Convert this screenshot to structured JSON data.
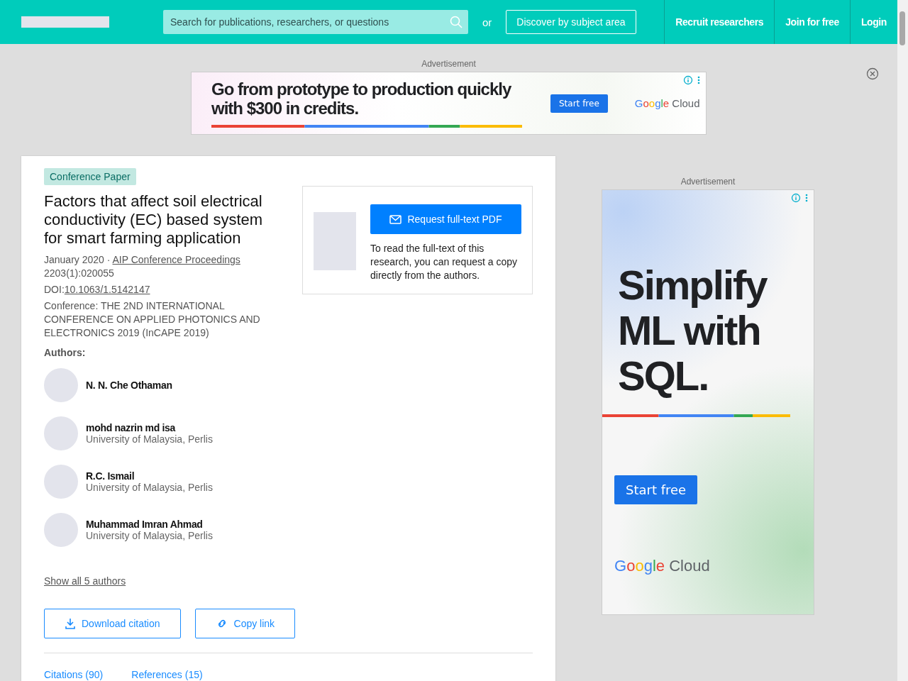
{
  "header": {
    "search": {
      "placeholder": "Search for publications, researchers, or questions"
    },
    "or_label": "or",
    "discover_button": "Discover by subject area",
    "nav": [
      "Recruit researchers",
      "Join for free",
      "Login"
    ]
  },
  "top_ad": {
    "label": "Advertisement",
    "headline": "Go from prototype to production quickly with $300 in credits.",
    "cta": "Start free",
    "logo": {
      "brand": "Google",
      "product": "Cloud"
    }
  },
  "publication": {
    "type_badge": "Conference Paper",
    "title": "Factors that affect soil electrical conductivity (EC) based system for smart farming application",
    "date": "January 2020 · ",
    "journal": "AIP Conference Proceedings",
    "issue": "2203(1):020055",
    "doi_label": "DOI:",
    "doi": "10.1063/1.5142147",
    "conference": "Conference: THE 2ND INTERNATIONAL CONFERENCE ON APPLIED PHOTONICS AND ELECTRONICS 2019 (InCAPE 2019)",
    "authors_label": "Authors:",
    "authors": [
      {
        "name": "N. N. Che Othaman"
      },
      {
        "name": "mohd nazrin md isa",
        "affiliation": "University of Malaysia, Perlis"
      },
      {
        "name": "R.C. Ismail",
        "affiliation": "University of Malaysia, Perlis"
      },
      {
        "name": "Muhammad Imran Ahmad",
        "affiliation": "University of Malaysia, Perlis"
      }
    ],
    "show_all": "Show all 5 authors",
    "actions": [
      "Download citation",
      "Copy link"
    ],
    "tabs": [
      {
        "label": "Citations (90)"
      },
      {
        "label": "References (15)"
      }
    ]
  },
  "request_box": {
    "button": "Request full-text PDF",
    "text": "To read the full-text of this research, you can request a copy directly from the authors."
  },
  "side_ad": {
    "label": "Advertisement",
    "headline": "Simplify ML with SQL.",
    "cta": "Start free",
    "logo": {
      "brand": "Google",
      "product": "Cloud"
    }
  }
}
